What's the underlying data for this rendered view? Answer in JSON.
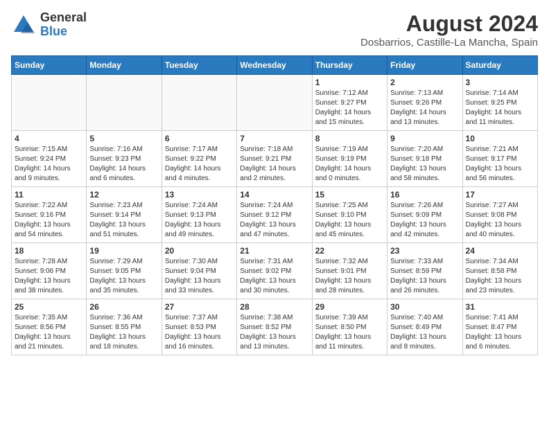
{
  "header": {
    "logo_line1": "General",
    "logo_line2": "Blue",
    "month_year": "August 2024",
    "location": "Dosbarrios, Castille-La Mancha, Spain"
  },
  "weekdays": [
    "Sunday",
    "Monday",
    "Tuesday",
    "Wednesday",
    "Thursday",
    "Friday",
    "Saturday"
  ],
  "weeks": [
    [
      {
        "day": "",
        "info": ""
      },
      {
        "day": "",
        "info": ""
      },
      {
        "day": "",
        "info": ""
      },
      {
        "day": "",
        "info": ""
      },
      {
        "day": "1",
        "info": "Sunrise: 7:12 AM\nSunset: 9:27 PM\nDaylight: 14 hours\nand 15 minutes."
      },
      {
        "day": "2",
        "info": "Sunrise: 7:13 AM\nSunset: 9:26 PM\nDaylight: 14 hours\nand 13 minutes."
      },
      {
        "day": "3",
        "info": "Sunrise: 7:14 AM\nSunset: 9:25 PM\nDaylight: 14 hours\nand 11 minutes."
      }
    ],
    [
      {
        "day": "4",
        "info": "Sunrise: 7:15 AM\nSunset: 9:24 PM\nDaylight: 14 hours\nand 9 minutes."
      },
      {
        "day": "5",
        "info": "Sunrise: 7:16 AM\nSunset: 9:23 PM\nDaylight: 14 hours\nand 6 minutes."
      },
      {
        "day": "6",
        "info": "Sunrise: 7:17 AM\nSunset: 9:22 PM\nDaylight: 14 hours\nand 4 minutes."
      },
      {
        "day": "7",
        "info": "Sunrise: 7:18 AM\nSunset: 9:21 PM\nDaylight: 14 hours\nand 2 minutes."
      },
      {
        "day": "8",
        "info": "Sunrise: 7:19 AM\nSunset: 9:19 PM\nDaylight: 14 hours\nand 0 minutes."
      },
      {
        "day": "9",
        "info": "Sunrise: 7:20 AM\nSunset: 9:18 PM\nDaylight: 13 hours\nand 58 minutes."
      },
      {
        "day": "10",
        "info": "Sunrise: 7:21 AM\nSunset: 9:17 PM\nDaylight: 13 hours\nand 56 minutes."
      }
    ],
    [
      {
        "day": "11",
        "info": "Sunrise: 7:22 AM\nSunset: 9:16 PM\nDaylight: 13 hours\nand 54 minutes."
      },
      {
        "day": "12",
        "info": "Sunrise: 7:23 AM\nSunset: 9:14 PM\nDaylight: 13 hours\nand 51 minutes."
      },
      {
        "day": "13",
        "info": "Sunrise: 7:24 AM\nSunset: 9:13 PM\nDaylight: 13 hours\nand 49 minutes."
      },
      {
        "day": "14",
        "info": "Sunrise: 7:24 AM\nSunset: 9:12 PM\nDaylight: 13 hours\nand 47 minutes."
      },
      {
        "day": "15",
        "info": "Sunrise: 7:25 AM\nSunset: 9:10 PM\nDaylight: 13 hours\nand 45 minutes."
      },
      {
        "day": "16",
        "info": "Sunrise: 7:26 AM\nSunset: 9:09 PM\nDaylight: 13 hours\nand 42 minutes."
      },
      {
        "day": "17",
        "info": "Sunrise: 7:27 AM\nSunset: 9:08 PM\nDaylight: 13 hours\nand 40 minutes."
      }
    ],
    [
      {
        "day": "18",
        "info": "Sunrise: 7:28 AM\nSunset: 9:06 PM\nDaylight: 13 hours\nand 38 minutes."
      },
      {
        "day": "19",
        "info": "Sunrise: 7:29 AM\nSunset: 9:05 PM\nDaylight: 13 hours\nand 35 minutes."
      },
      {
        "day": "20",
        "info": "Sunrise: 7:30 AM\nSunset: 9:04 PM\nDaylight: 13 hours\nand 33 minutes."
      },
      {
        "day": "21",
        "info": "Sunrise: 7:31 AM\nSunset: 9:02 PM\nDaylight: 13 hours\nand 30 minutes."
      },
      {
        "day": "22",
        "info": "Sunrise: 7:32 AM\nSunset: 9:01 PM\nDaylight: 13 hours\nand 28 minutes."
      },
      {
        "day": "23",
        "info": "Sunrise: 7:33 AM\nSunset: 8:59 PM\nDaylight: 13 hours\nand 26 minutes."
      },
      {
        "day": "24",
        "info": "Sunrise: 7:34 AM\nSunset: 8:58 PM\nDaylight: 13 hours\nand 23 minutes."
      }
    ],
    [
      {
        "day": "25",
        "info": "Sunrise: 7:35 AM\nSunset: 8:56 PM\nDaylight: 13 hours\nand 21 minutes."
      },
      {
        "day": "26",
        "info": "Sunrise: 7:36 AM\nSunset: 8:55 PM\nDaylight: 13 hours\nand 18 minutes."
      },
      {
        "day": "27",
        "info": "Sunrise: 7:37 AM\nSunset: 8:53 PM\nDaylight: 13 hours\nand 16 minutes."
      },
      {
        "day": "28",
        "info": "Sunrise: 7:38 AM\nSunset: 8:52 PM\nDaylight: 13 hours\nand 13 minutes."
      },
      {
        "day": "29",
        "info": "Sunrise: 7:39 AM\nSunset: 8:50 PM\nDaylight: 13 hours\nand 11 minutes."
      },
      {
        "day": "30",
        "info": "Sunrise: 7:40 AM\nSunset: 8:49 PM\nDaylight: 13 hours\nand 8 minutes."
      },
      {
        "day": "31",
        "info": "Sunrise: 7:41 AM\nSunset: 8:47 PM\nDaylight: 13 hours\nand 6 minutes."
      }
    ]
  ]
}
